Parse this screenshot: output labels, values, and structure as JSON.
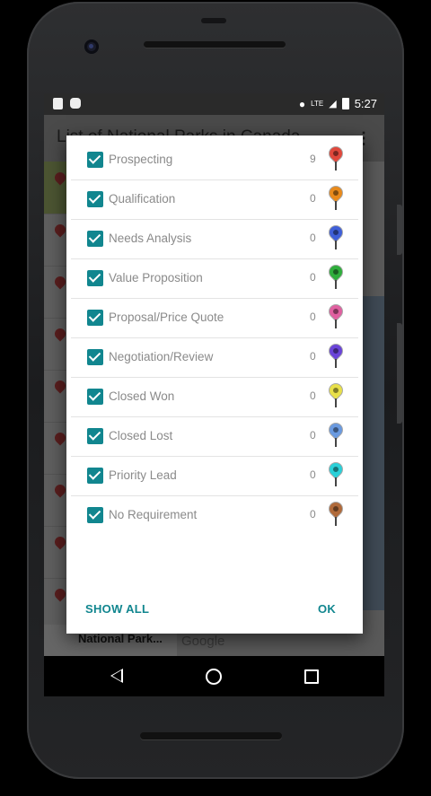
{
  "status": {
    "time": "5:27",
    "network": "LTE"
  },
  "app": {
    "title": "List of National Parks in Canada"
  },
  "background": {
    "footer_text": "National Park...",
    "map_logo": "Google"
  },
  "dialog": {
    "items": [
      {
        "label": "Prospecting",
        "count": "9",
        "color": "#e0483c",
        "checked": true
      },
      {
        "label": "Qualification",
        "count": "0",
        "color": "#e88a1c",
        "checked": true
      },
      {
        "label": "Needs Analysis",
        "count": "0",
        "color": "#3f5fd8",
        "checked": true
      },
      {
        "label": "Value Proposition",
        "count": "0",
        "color": "#2fae3c",
        "checked": true
      },
      {
        "label": "Proposal/Price Quote",
        "count": "0",
        "color": "#e060a0",
        "checked": true
      },
      {
        "label": "Negotiation/Review",
        "count": "0",
        "color": "#6a44d8",
        "checked": true
      },
      {
        "label": "Closed Won",
        "count": "0",
        "color": "#e8e04a",
        "checked": true
      },
      {
        "label": "Closed Lost",
        "count": "0",
        "color": "#6a9ae0",
        "checked": true
      },
      {
        "label": "Priority Lead",
        "count": "0",
        "color": "#2ad0d8",
        "checked": true
      },
      {
        "label": "No Requirement",
        "count": "0",
        "color": "#b06a3a",
        "checked": true
      }
    ],
    "show_all_label": "SHOW ALL",
    "ok_label": "OK"
  }
}
